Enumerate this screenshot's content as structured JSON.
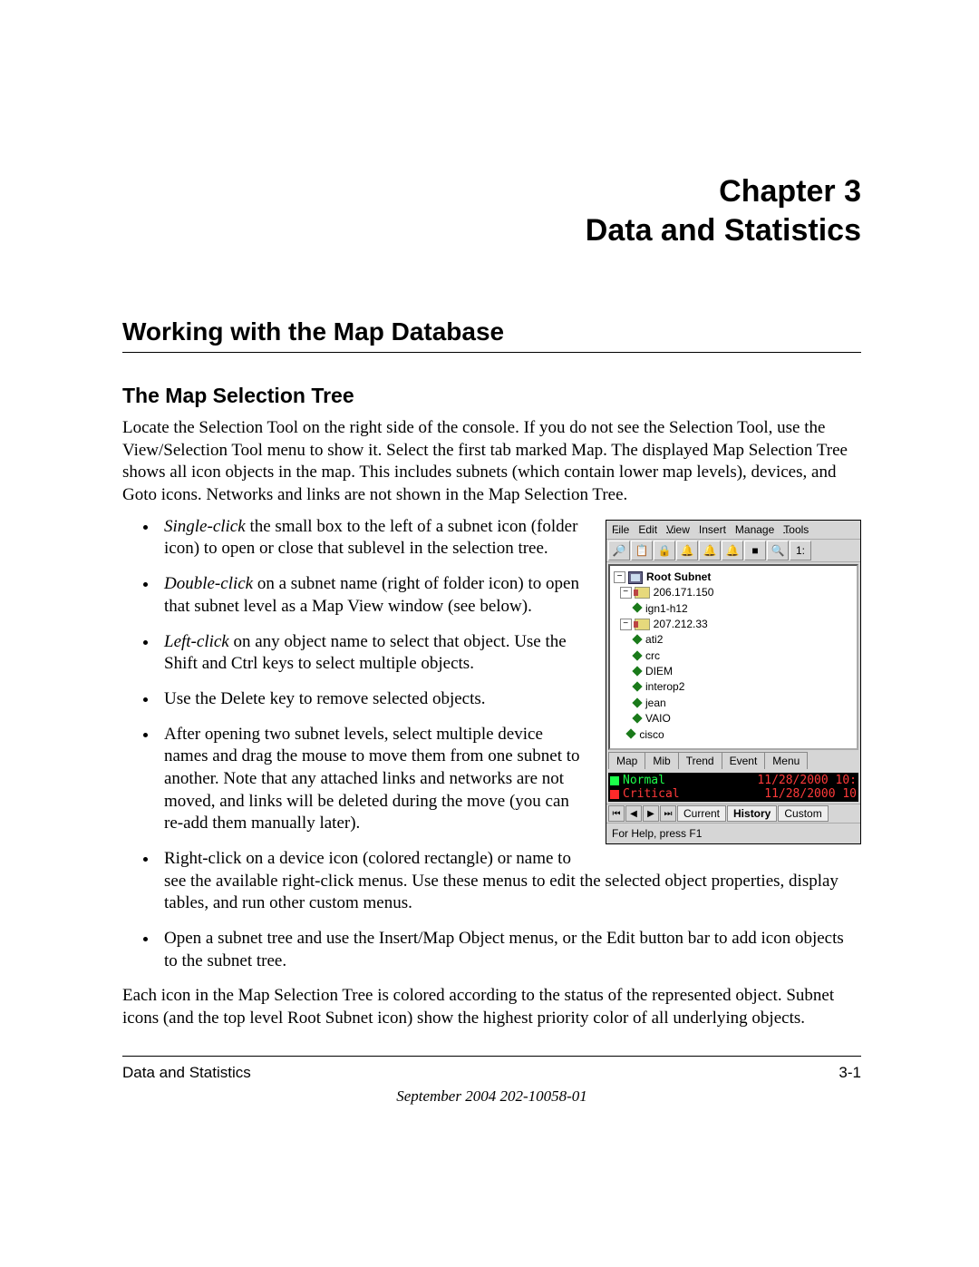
{
  "chapter": {
    "line1": "Chapter 3",
    "line2": "Data and Statistics"
  },
  "h1": "Working with the Map Database",
  "h2": "The Map Selection Tree",
  "intro": "Locate the Selection Tool on the right side of the console. If you do not see the Selection Tool, use the View/Selection Tool menu to show it. Select the first tab marked Map. The displayed Map Selection Tree shows all icon objects in the map. This includes subnets (which contain lower map levels), devices, and Goto icons. Networks and links are not shown in the Map Selection Tree.",
  "bullets": [
    {
      "lead_italic": "Single-click",
      "rest": " the small box to the left of a subnet icon (folder icon) to open or close that sublevel in the selection tree."
    },
    {
      "lead_italic": "Double-click",
      "rest": " on a subnet name (right of folder icon) to open that subnet level as a Map View window (see below)."
    },
    {
      "lead_italic": "Left-click",
      "rest": " on any object name to select that object. Use the Shift and Ctrl keys to select multiple objects."
    },
    {
      "plain": "Use the Delete key to remove selected objects."
    },
    {
      "plain": "After opening two subnet levels, select multiple device names and drag the mouse to move them from one subnet to another. Note that any attached links and networks are not moved, and links will be deleted during the move (you can re-add them manually later)."
    },
    {
      "plain": "Right-click on a device icon (colored rectangle) or name to see the available right-click menus. Use these menus to edit the selected object properties, display tables, and run other custom menus."
    },
    {
      "plain": "Open a subnet tree and use the Insert/Map Object menus, or the Edit button bar to add icon objects to the subnet tree."
    }
  ],
  "closing": "Each icon in the Map Selection Tree is colored according to the status of the represented object. Subnet icons (and the top level Root Subnet icon) show the highest priority color of all underlying objects.",
  "figure": {
    "menubar": [
      "File",
      "Edit",
      "View",
      "Insert",
      "Manage",
      "Tools"
    ],
    "toolbar_icons": [
      "binoculars-icon",
      "clipboard-icon",
      "lock-icon",
      "bell-icon",
      "bell2-icon",
      "bell3-icon",
      "stop-icon",
      "magnifier-icon",
      "one-icon"
    ],
    "toolbar_glyphs": [
      "🔎",
      "📋",
      "🔒",
      "🔔",
      "🔔",
      "🔔",
      "■",
      "🔍",
      "1:"
    ],
    "tree": {
      "root": "Root Subnet",
      "subnets": [
        {
          "name": "206.171.150",
          "children": [
            "ign1-h12"
          ]
        },
        {
          "name": "207.212.33",
          "children": [
            "ati2",
            "crc",
            "DIEM",
            "interop2",
            "jean",
            "VAIO"
          ]
        }
      ],
      "loose": [
        "cisco"
      ]
    },
    "tabs": [
      "Map",
      "Mib",
      "Trend",
      "Event",
      "Menu"
    ],
    "status": [
      {
        "kind": "normal",
        "label": "Normal",
        "date": "11/28/2000",
        "tail": "10:"
      },
      {
        "kind": "critical",
        "label": "Critical",
        "date": "11/28/2000",
        "tail": "10"
      }
    ],
    "nav_tabs": [
      "Current",
      "History",
      "Custom"
    ],
    "help": "For Help, press F1"
  },
  "footer": {
    "left": "Data and Statistics",
    "right": "3-1",
    "date": "September 2004 202-10058-01"
  }
}
